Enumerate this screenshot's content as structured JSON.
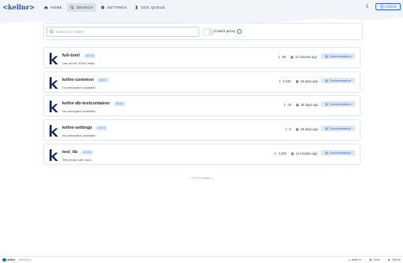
{
  "header": {
    "logo": "<kellnr>",
    "nav": [
      {
        "label": "HOME",
        "icon": "home-icon",
        "active": false
      },
      {
        "label": "SEARCH",
        "icon": "search-icon",
        "active": true
      },
      {
        "label": "SETTINGS",
        "icon": "gear-icon",
        "active": false
      },
      {
        "label": "DOC QUEUE",
        "icon": "queue-icon",
        "active": false
      }
    ],
    "theme_icon": "moon-icon",
    "login_label": "LOGIN"
  },
  "search": {
    "placeholder": "Search for crates",
    "value": "",
    "proxy_label": "Crates proxy",
    "proxy_enabled": false
  },
  "crates": [
    {
      "name": "full-toml",
      "version": "v0.0.0",
      "description": "Use all the TOML fields",
      "downloads": "66",
      "updated": "12 minutes ago",
      "doc_label": "Documentation"
    },
    {
      "name": "kellnr-common",
      "version": "v0.0.1",
      "description": "No description available",
      "downloads": "6,443",
      "updated": "18 days ago",
      "doc_label": "Documentation"
    },
    {
      "name": "kellnr-db-testcontainer",
      "version": "v0.0.1",
      "description": "No description available",
      "downloads": "43",
      "updated": "18 days ago",
      "doc_label": "Documentation"
    },
    {
      "name": "kellnr-settings",
      "version": "v0.0.1",
      "description": "No description available",
      "downloads": "5",
      "updated": "18 days ago",
      "doc_label": "Documentation"
    },
    {
      "name": "test_lib",
      "version": "v1.0.0",
      "description": "Test library with docs",
      "downloads": "4,225",
      "updated": "14 minutes ago",
      "doc_label": "Documentation"
    }
  ],
  "end_text": "— End of crates —",
  "footer": {
    "brand": "kellnr",
    "version": "v6.0.0-rc.1",
    "links": [
      {
        "label": "kellnr.io",
        "icon": "globe-icon"
      },
      {
        "label": "Docs",
        "icon": "book-icon"
      },
      {
        "label": "GitHub",
        "icon": "github-icon"
      }
    ]
  },
  "colors": {
    "accent": "#2563eb",
    "badge_bg": "#dbeafe",
    "logo": "#1d4ed8",
    "k_logo": "#0a1f66"
  }
}
